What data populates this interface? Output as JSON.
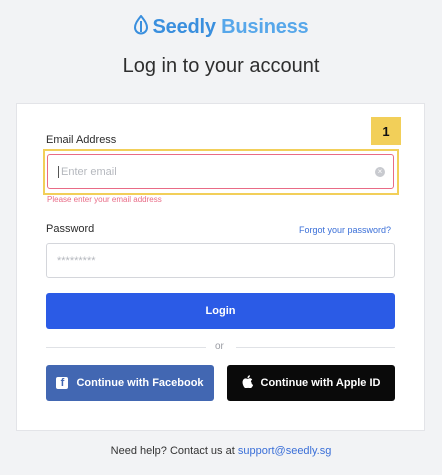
{
  "brand": {
    "name_part1": "Seedly",
    "name_part2": "Business",
    "icon": "seed-drop-icon"
  },
  "page": {
    "title": "Log in to your account"
  },
  "form": {
    "email_label": "Email Address",
    "email_placeholder": "Enter email",
    "email_value": "",
    "email_error": "Please enter your email address",
    "password_label": "Password",
    "password_placeholder": "*********",
    "forgot_link": "Forgot your password?",
    "login_button": "Login",
    "divider": "or",
    "facebook_button": "Continue with Facebook",
    "apple_button": "Continue with Apple ID"
  },
  "annotation": {
    "badge": "1"
  },
  "footer": {
    "help_text": "Need help? Contact us at",
    "support_email": "support@seedly.sg"
  },
  "colors": {
    "accent": "#2b5be6",
    "facebook": "#4267b2",
    "error": "#e96b86",
    "highlight": "#f2cf59"
  }
}
